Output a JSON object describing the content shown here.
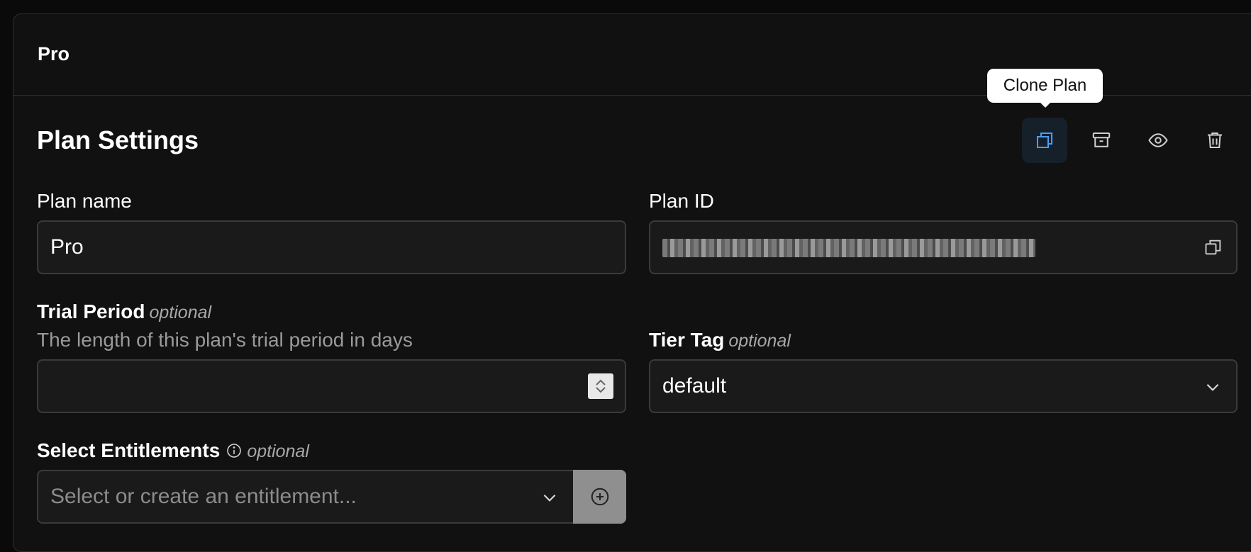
{
  "card": {
    "title": "Pro"
  },
  "section": {
    "title": "Plan Settings"
  },
  "actions": {
    "tooltip": "Clone Plan",
    "items": [
      {
        "icon": "clone-icon",
        "active": true
      },
      {
        "icon": "archive-icon",
        "active": false
      },
      {
        "icon": "eye-icon",
        "active": false
      },
      {
        "icon": "trash-icon",
        "active": false
      }
    ]
  },
  "form": {
    "plan_name": {
      "label": "Plan name",
      "value": "Pro"
    },
    "plan_id": {
      "label": "Plan ID",
      "copy_icon": "copy-icon"
    },
    "trial_period": {
      "label": "Trial Period",
      "optional": "optional",
      "hint": "The length of this plan's trial period in days",
      "value": ""
    },
    "tier_tag": {
      "label": "Tier Tag",
      "optional": "optional",
      "value": "default"
    },
    "entitlements": {
      "label": "Select Entitlements",
      "optional": "optional",
      "placeholder": "Select or create an entitlement..."
    }
  },
  "colors": {
    "background": "#0a0a0a",
    "card": "#111111",
    "accent": "#4a9ef5",
    "border": "#3a3a3a"
  }
}
